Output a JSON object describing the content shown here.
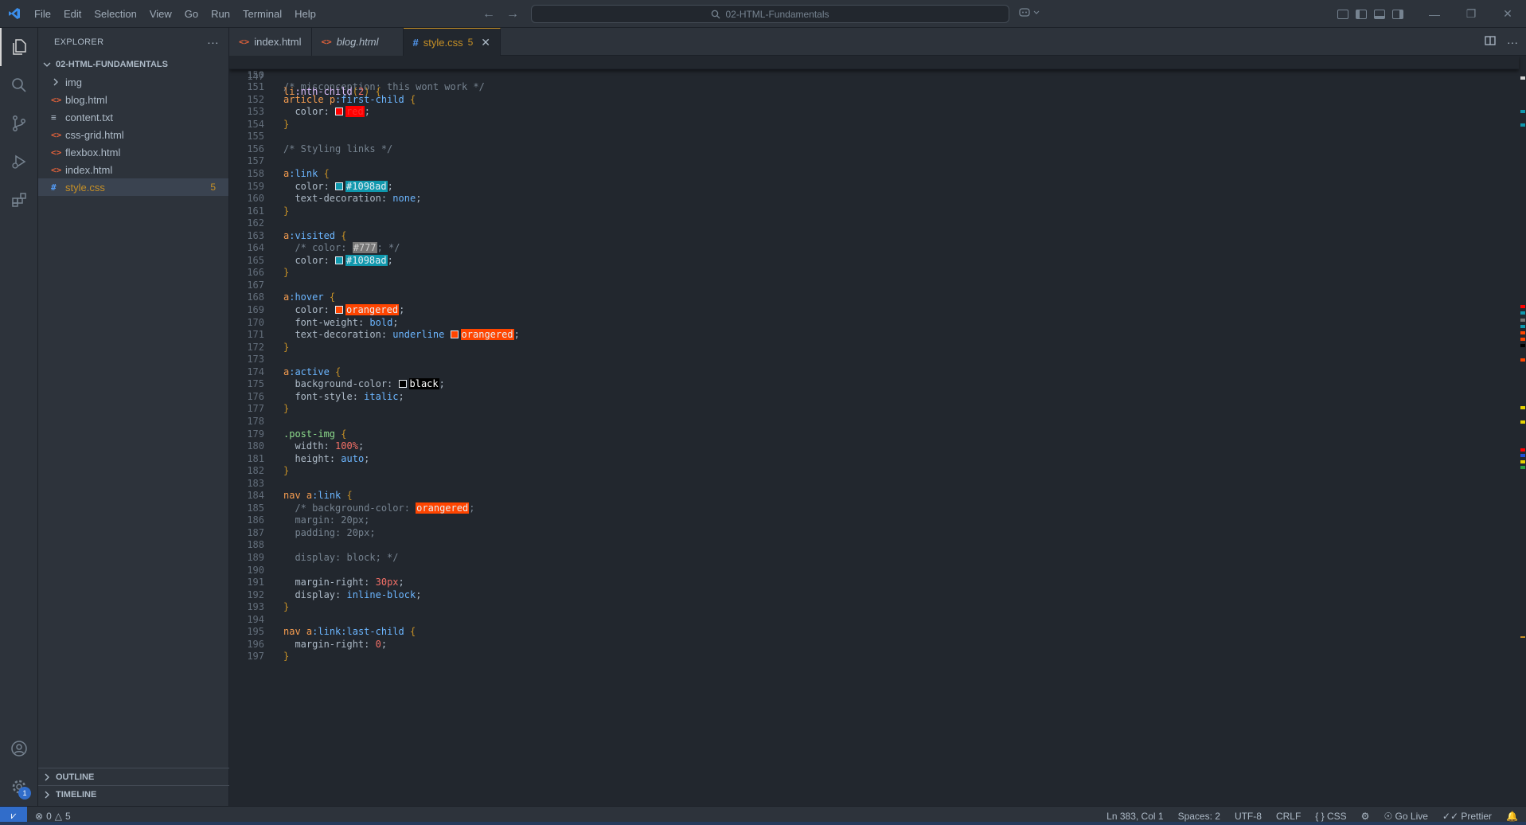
{
  "titlebar": {
    "menu": [
      "File",
      "Edit",
      "Selection",
      "View",
      "Go",
      "Run",
      "Terminal",
      "Help"
    ],
    "search_text": "02-HTML-Fundamentals",
    "icons": [
      "vscode-logo",
      "arrow-left-icon",
      "arrow-right-icon",
      "search-icon",
      "copilot-icon",
      "layout-icons",
      "minimize-icon",
      "restore-icon",
      "close-icon"
    ]
  },
  "sidebar": {
    "title": "EXPLORER",
    "more": "···",
    "folder": "02-HTML-FUNDAMENTALS",
    "items": [
      {
        "name": "img",
        "type": "folder"
      },
      {
        "name": "blog.html",
        "type": "html"
      },
      {
        "name": "content.txt",
        "type": "txt"
      },
      {
        "name": "css-grid.html",
        "type": "html"
      },
      {
        "name": "flexbox.html",
        "type": "html"
      },
      {
        "name": "index.html",
        "type": "html"
      },
      {
        "name": "style.css",
        "type": "css",
        "count": "5",
        "selected": true
      }
    ],
    "outline": "OUTLINE",
    "timeline": "TIMELINE"
  },
  "tabs": [
    {
      "label": "index.html",
      "type": "html",
      "italic": false,
      "active": false
    },
    {
      "label": "blog.html",
      "type": "html",
      "italic": true,
      "active": false
    },
    {
      "label": "style.css",
      "type": "css",
      "italic": false,
      "active": true,
      "count": "5"
    }
  ],
  "editor": {
    "sticky": {
      "ln": "147",
      "code": "li:nth-child(2) {"
    },
    "lines": [
      {
        "ln": "149",
        "code": "}"
      },
      {
        "ln": "150",
        "code": ""
      },
      {
        "ln": "151",
        "code": "/* misconception: this wont work */"
      },
      {
        "ln": "152",
        "code": "article p:first-child {"
      },
      {
        "ln": "153",
        "code": "  color: red;"
      },
      {
        "ln": "154",
        "code": "}"
      },
      {
        "ln": "155",
        "code": ""
      },
      {
        "ln": "156",
        "code": "/* Styling links */"
      },
      {
        "ln": "157",
        "code": ""
      },
      {
        "ln": "158",
        "code": "a:link {"
      },
      {
        "ln": "159",
        "code": "  color: #1098ad;"
      },
      {
        "ln": "160",
        "code": "  text-decoration: none;"
      },
      {
        "ln": "161",
        "code": "}"
      },
      {
        "ln": "162",
        "code": ""
      },
      {
        "ln": "163",
        "code": "a:visited {"
      },
      {
        "ln": "164",
        "code": "  /* color: #777; */"
      },
      {
        "ln": "165",
        "code": "  color: #1098ad;"
      },
      {
        "ln": "166",
        "code": "}"
      },
      {
        "ln": "167",
        "code": ""
      },
      {
        "ln": "168",
        "code": "a:hover {"
      },
      {
        "ln": "169",
        "code": "  color: orangered;"
      },
      {
        "ln": "170",
        "code": "  font-weight: bold;"
      },
      {
        "ln": "171",
        "code": "  text-decoration: underline orangered;"
      },
      {
        "ln": "172",
        "code": "}"
      },
      {
        "ln": "173",
        "code": ""
      },
      {
        "ln": "174",
        "code": "a:active {"
      },
      {
        "ln": "175",
        "code": "  background-color: black;"
      },
      {
        "ln": "176",
        "code": "  font-style: italic;"
      },
      {
        "ln": "177",
        "code": "}"
      },
      {
        "ln": "178",
        "code": ""
      },
      {
        "ln": "179",
        "code": ".post-img {"
      },
      {
        "ln": "180",
        "code": "  width: 100%;"
      },
      {
        "ln": "181",
        "code": "  height: auto;"
      },
      {
        "ln": "182",
        "code": "}"
      },
      {
        "ln": "183",
        "code": ""
      },
      {
        "ln": "184",
        "code": "nav a:link {"
      },
      {
        "ln": "185",
        "code": "  /* background-color: orangered;"
      },
      {
        "ln": "186",
        "code": "  margin: 20px;"
      },
      {
        "ln": "187",
        "code": "  padding: 20px;"
      },
      {
        "ln": "188",
        "code": ""
      },
      {
        "ln": "189",
        "code": "  display: block; */"
      },
      {
        "ln": "190",
        "code": ""
      },
      {
        "ln": "191",
        "code": "  margin-right: 30px;"
      },
      {
        "ln": "192",
        "code": "  display: inline-block;"
      },
      {
        "ln": "193",
        "code": "}"
      },
      {
        "ln": "194",
        "code": ""
      },
      {
        "ln": "195",
        "code": "nav a:link:last-child {"
      },
      {
        "ln": "196",
        "code": "  margin-right: 0;"
      },
      {
        "ln": "197",
        "code": "}"
      }
    ]
  },
  "statusbar": {
    "errors": "0",
    "warnings": "5",
    "position": "Ln 383, Col 1",
    "spaces": "Spaces: 2",
    "encoding": "UTF-8",
    "eol": "CRLF",
    "language": "CSS",
    "golive": "Go Live",
    "prettier": "Prettier"
  },
  "colors": {
    "accent": "#c69026",
    "red": "#ff0000",
    "teal": "#1098ad",
    "gray": "#777777",
    "orangered": "#ff4500",
    "black": "#000000"
  }
}
